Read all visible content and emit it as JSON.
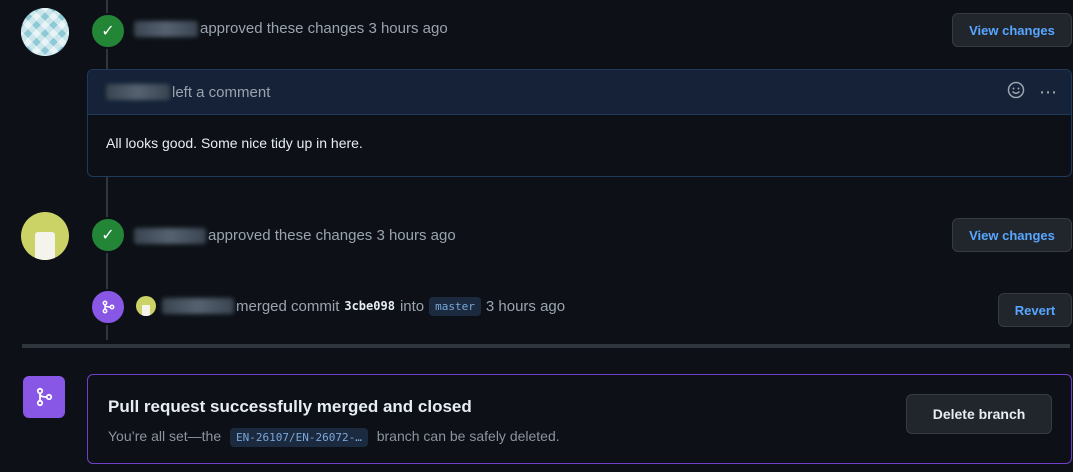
{
  "timeline": {
    "approval_1": {
      "text": "approved these changes 3 hours ago",
      "button": "View changes"
    },
    "comment": {
      "header_text": "left a comment",
      "body": "All looks good. Some nice tidy up in here.",
      "emoji_icon": "smiley-icon",
      "menu_icon": "kebab-menu-icon"
    },
    "approval_2": {
      "text": "approved these changes 3 hours ago",
      "button": "View changes"
    },
    "merge_event": {
      "prefix": "merged commit",
      "commit_sha": "3cbe098",
      "into": "into",
      "branch": "master",
      "time": "3 hours ago",
      "button": "Revert"
    }
  },
  "merged_box": {
    "title": "Pull request successfully merged and closed",
    "subtitle_prefix": "You’re all set—the",
    "branch": "EN-26107/EN-26072-…",
    "subtitle_suffix": "branch can be safely deleted.",
    "delete_button": "Delete branch"
  },
  "colors": {
    "background": "#0d1117",
    "approved_green": "#238636",
    "merged_purple": "#8957e5",
    "link_blue": "#58a6ff"
  }
}
